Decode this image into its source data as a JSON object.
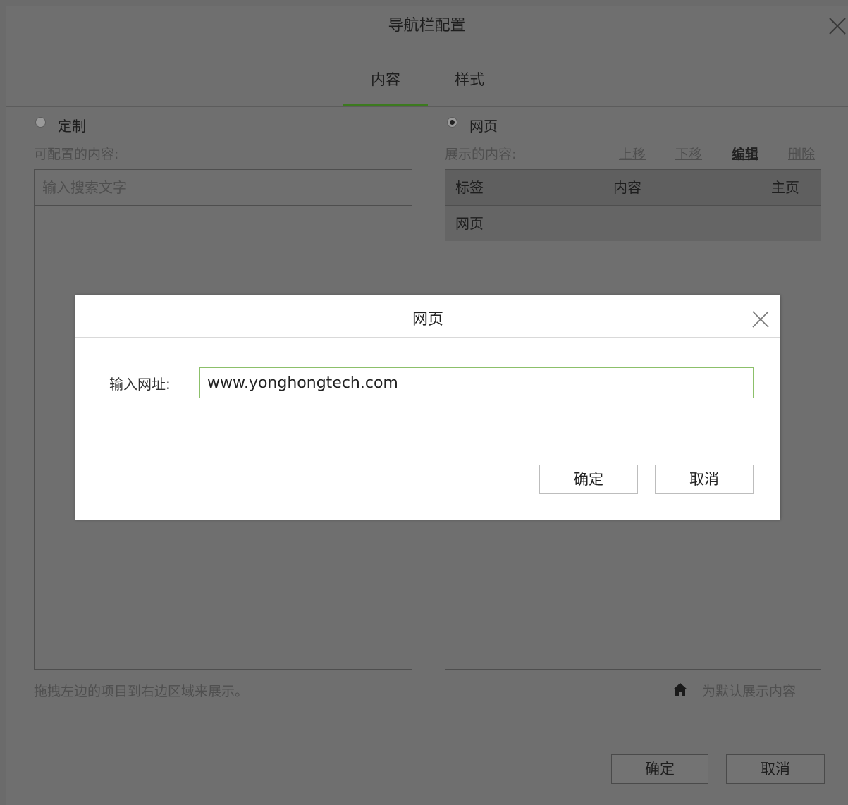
{
  "outer_dialog": {
    "title": "导航栏配置",
    "tabs": [
      {
        "label": "内容"
      },
      {
        "label": "样式"
      }
    ],
    "left": {
      "radio_label": "定制",
      "section_label": "可配置的内容:",
      "search_placeholder": "输入搜索文字",
      "hint": "拖拽左边的项目到右边区域来展示。"
    },
    "right": {
      "radio_label": "网页",
      "section_label": "展示的内容:",
      "actions": [
        "上移",
        "下移",
        "编辑",
        "删除"
      ],
      "columns": [
        "标签",
        "内容",
        "主页"
      ],
      "rows": [
        {
          "label": "网页",
          "content": "",
          "home": ""
        }
      ],
      "home_hint": "为默认展示内容"
    },
    "ok_label": "确定",
    "cancel_label": "取消"
  },
  "modal": {
    "title": "网页",
    "field_label": "输入网址:",
    "field_value": "www.yonghongtech.com",
    "ok_label": "确定",
    "cancel_label": "取消"
  },
  "colors": {
    "accent": "#3c7a1f",
    "input_border": "#8cc06a",
    "overlay": "#6f6f6f"
  }
}
